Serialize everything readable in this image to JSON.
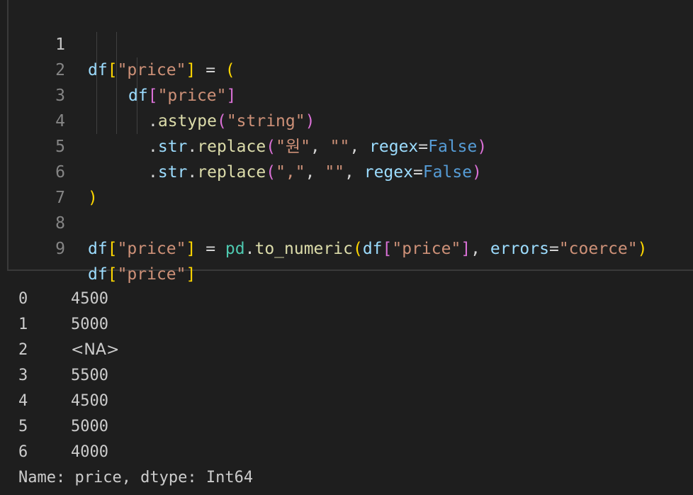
{
  "code": {
    "lines": [
      {
        "number": "1",
        "tokens": {
          "a": "df",
          "b": "[",
          "c": "\"price\"",
          "d": "]",
          "e": " = ",
          "f": "("
        }
      },
      {
        "number": "2",
        "tokens": {
          "a": "df",
          "b": "[",
          "c": "\"price\"",
          "d": "]"
        }
      },
      {
        "number": "3",
        "tokens": {
          "a": ".",
          "b": "astype",
          "c": "(",
          "d": "\"string\"",
          "e": ")"
        }
      },
      {
        "number": "4",
        "tokens": {
          "a": ".",
          "b": "str",
          "c": ".",
          "d": "replace",
          "e": "(",
          "f": "\"원\"",
          "g": ", ",
          "h": "\"\"",
          "i": ", ",
          "j": "regex",
          "k": "=",
          "l": "False",
          "m": ")"
        }
      },
      {
        "number": "5",
        "tokens": {
          "a": ".",
          "b": "str",
          "c": ".",
          "d": "replace",
          "e": "(",
          "f": "\",\"",
          "g": ", ",
          "h": "\"\"",
          "i": ", ",
          "j": "regex",
          "k": "=",
          "l": "False",
          "m": ")"
        }
      },
      {
        "number": "6",
        "tokens": {
          "a": ")"
        }
      },
      {
        "number": "7",
        "tokens": {}
      },
      {
        "number": "8",
        "tokens": {
          "a": "df",
          "b": "[",
          "c": "\"price\"",
          "d": "]",
          "e": " = ",
          "f": "pd",
          "g": ".",
          "h": "to_numeric",
          "i": "(",
          "j": "df",
          "k": "[",
          "l": "\"price\"",
          "m": "]",
          "n": ", ",
          "o": "errors",
          "p": "=",
          "q": "\"coerce\"",
          "r": ")"
        }
      },
      {
        "number": "9",
        "tokens": {
          "a": "df",
          "b": "[",
          "c": "\"price\"",
          "d": "]"
        }
      }
    ]
  },
  "output": {
    "rows": [
      {
        "index": "0",
        "value": "4500"
      },
      {
        "index": "1",
        "value": "5000"
      },
      {
        "index": "2",
        "value": "<NA>"
      },
      {
        "index": "3",
        "value": "5500"
      },
      {
        "index": "4",
        "value": "4500"
      },
      {
        "index": "5",
        "value": "5000"
      },
      {
        "index": "6",
        "value": "4000"
      }
    ],
    "footer": "Name: price, dtype: Int64"
  },
  "colors": {
    "background": "#1e1e1e",
    "variable": "#9cdcfe",
    "string": "#ce9178",
    "function": "#dcdcaa",
    "module": "#4ec9b0",
    "keyword": "#569cd6",
    "bracket_level1": "#ffd700",
    "bracket_level2": "#da70d6",
    "bracket_level3": "#179fff"
  }
}
